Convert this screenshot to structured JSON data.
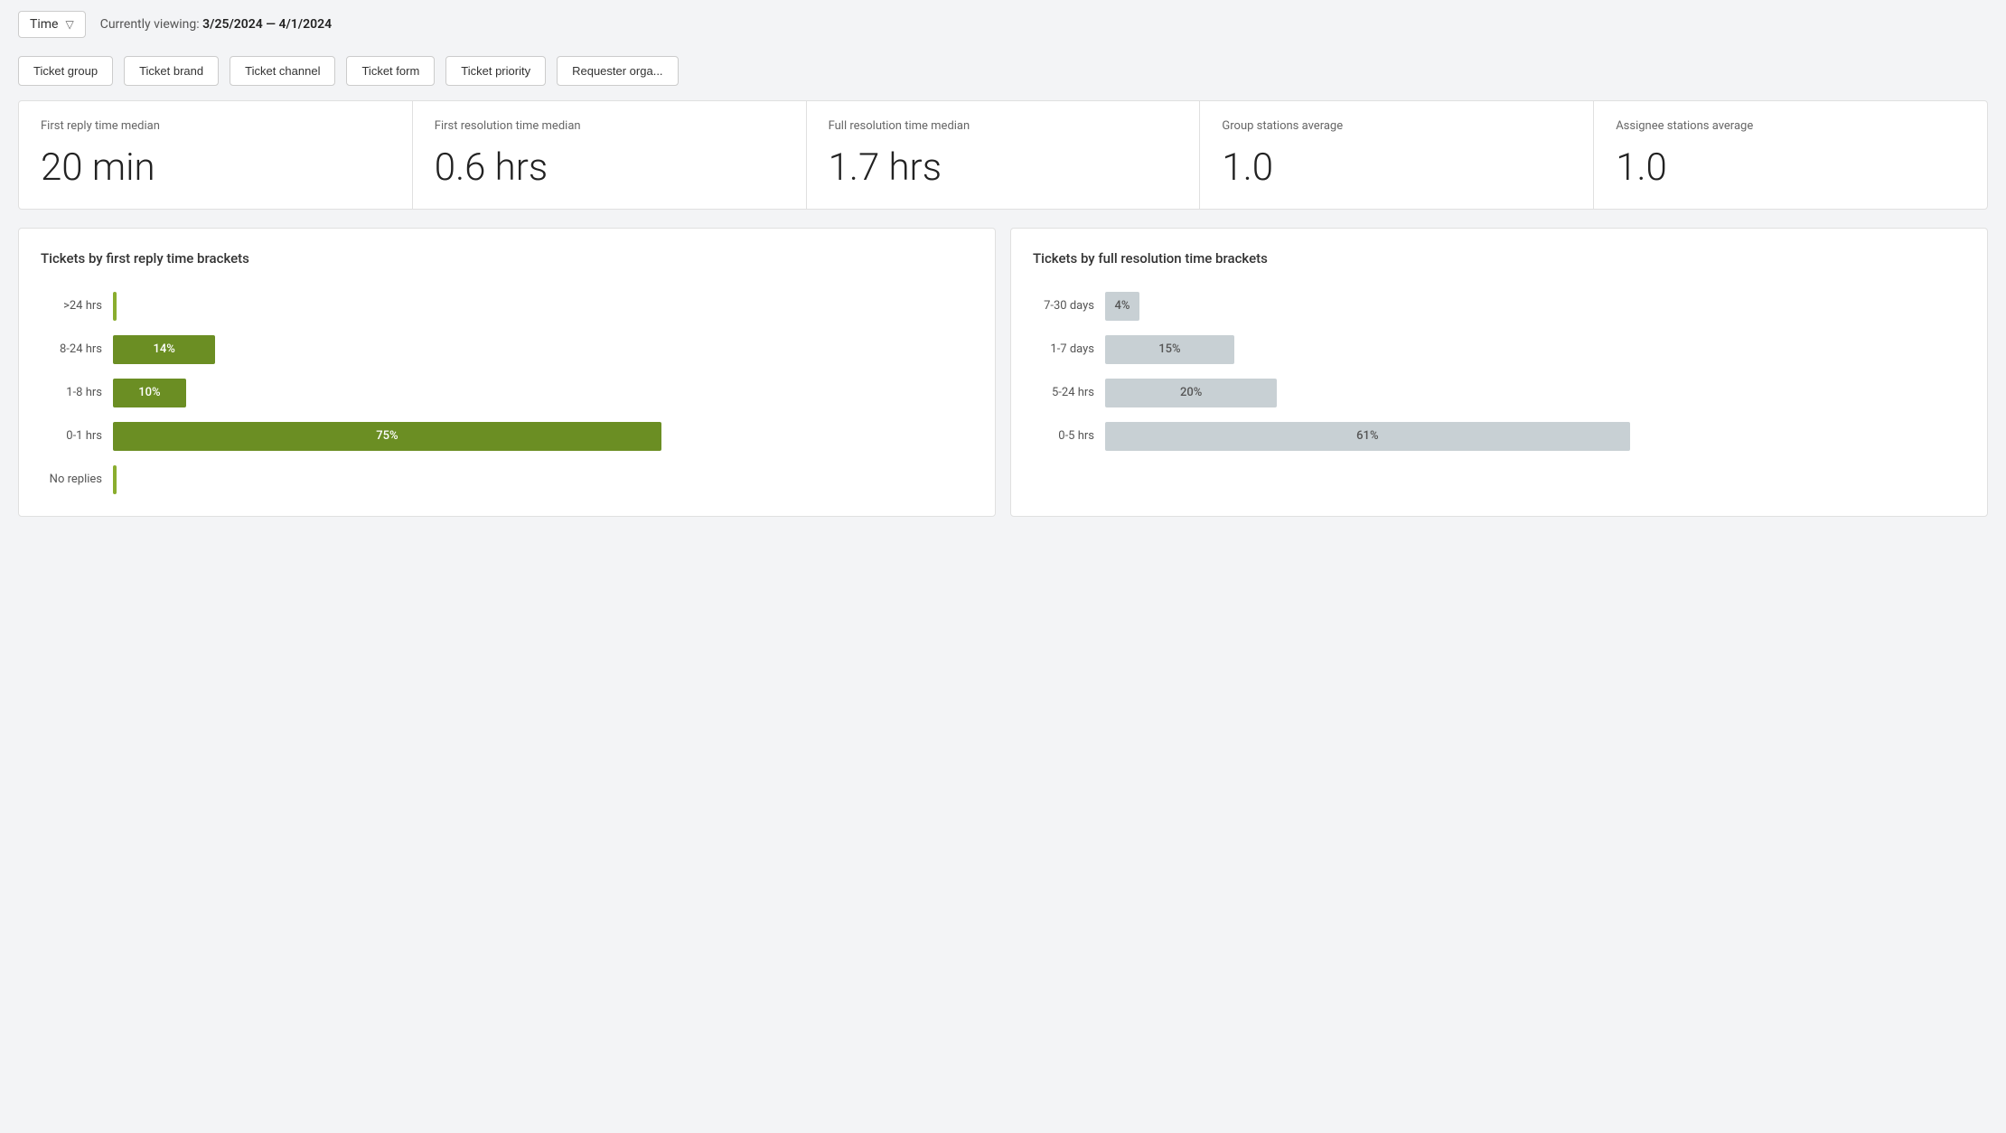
{
  "topbar": {
    "time_label": "Time",
    "filter_icon": "▽",
    "currently_viewing_prefix": "Currently viewing: ",
    "date_range": "3/25/2024 — 4/1/2024"
  },
  "filters": [
    {
      "id": "ticket-group",
      "label": "Ticket group"
    },
    {
      "id": "ticket-brand",
      "label": "Ticket brand"
    },
    {
      "id": "ticket-channel",
      "label": "Ticket channel"
    },
    {
      "id": "ticket-form",
      "label": "Ticket form"
    },
    {
      "id": "ticket-priority",
      "label": "Ticket priority"
    },
    {
      "id": "requester-org",
      "label": "Requester orga..."
    }
  ],
  "metrics": [
    {
      "id": "first-reply-median",
      "label": "First reply time median",
      "value": "20 min"
    },
    {
      "id": "first-resolution-median",
      "label": "First resolution time median",
      "value": "0.6 hrs"
    },
    {
      "id": "full-resolution-median",
      "label": "Full resolution time median",
      "value": "1.7 hrs"
    },
    {
      "id": "group-stations-avg",
      "label": "Group stations average",
      "value": "1.0"
    },
    {
      "id": "assignee-stations-avg",
      "label": "Assignee stations average",
      "value": "1.0"
    }
  ],
  "chart_left": {
    "title": "Tickets by first reply time brackets",
    "bars": [
      {
        "label": ">24 hrs",
        "pct": 1,
        "display": "",
        "type": "thin"
      },
      {
        "label": "8-24 hrs",
        "pct": 14,
        "display": "14%",
        "type": "green"
      },
      {
        "label": "1-8 hrs",
        "pct": 10,
        "display": "10%",
        "type": "green"
      },
      {
        "label": "0-1 hrs",
        "pct": 75,
        "display": "75%",
        "type": "green"
      },
      {
        "label": "No replies",
        "pct": 1,
        "display": "",
        "type": "thin"
      }
    ]
  },
  "chart_right": {
    "title": "Tickets by full resolution time brackets",
    "bars": [
      {
        "label": "7-30 days",
        "pct": 4,
        "display": "4%",
        "type": "gray"
      },
      {
        "label": "1-7 days",
        "pct": 15,
        "display": "15%",
        "type": "gray"
      },
      {
        "label": "5-24 hrs",
        "pct": 20,
        "display": "20%",
        "type": "gray"
      },
      {
        "label": "0-5 hrs",
        "pct": 61,
        "display": "61%",
        "type": "gray"
      }
    ]
  }
}
